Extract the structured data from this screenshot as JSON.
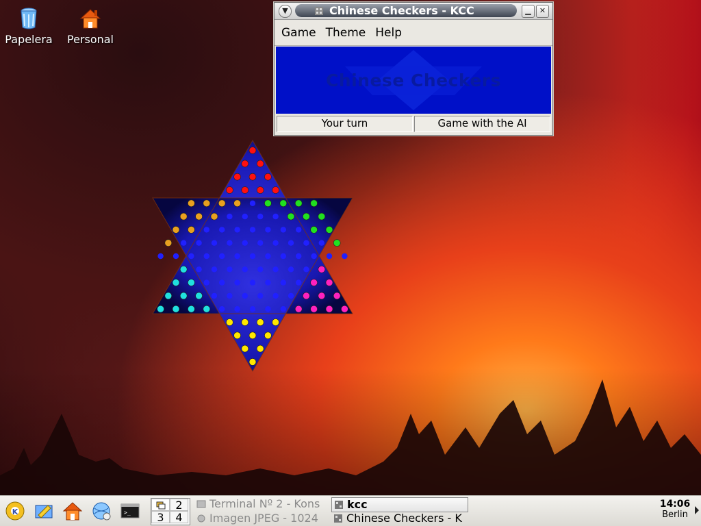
{
  "desktop": {
    "icons": [
      {
        "label": "Papelera",
        "icon": "trash-icon"
      },
      {
        "label": "Personal",
        "icon": "home-folder-icon"
      }
    ]
  },
  "window": {
    "title": "Chinese Checkers - KCC",
    "menu": [
      "Game",
      "Theme",
      "Help"
    ],
    "banner": "Chinese Checkers",
    "status": {
      "left": "Your turn",
      "right": "Game with the AI"
    }
  },
  "board": {
    "colors": {
      "red": "#ff1010",
      "orange": "#e8a020",
      "green": "#20e020",
      "cyan": "#20e0e0",
      "magenta": "#ff20c0",
      "yellow": "#ffe800",
      "empty": "#2020ff",
      "board": "#1a1ab4"
    },
    "corners": {
      "top": "red",
      "upper_left": "orange",
      "upper_right": "green",
      "lower_left": "cyan",
      "lower_right": "magenta",
      "bottom": "yellow"
    }
  },
  "taskbar": {
    "pager": [
      "1",
      "2",
      "3",
      "4"
    ],
    "tasks": [
      {
        "label": "Terminal Nº 2 - Kons",
        "active": false
      },
      {
        "label": "kcc",
        "active": true
      },
      {
        "label": "Imagen JPEG - 1024",
        "active": false
      },
      {
        "label": "Chinese Checkers - K",
        "active": true
      }
    ],
    "clock": {
      "time": "14:06",
      "zone": "Berlin"
    }
  }
}
